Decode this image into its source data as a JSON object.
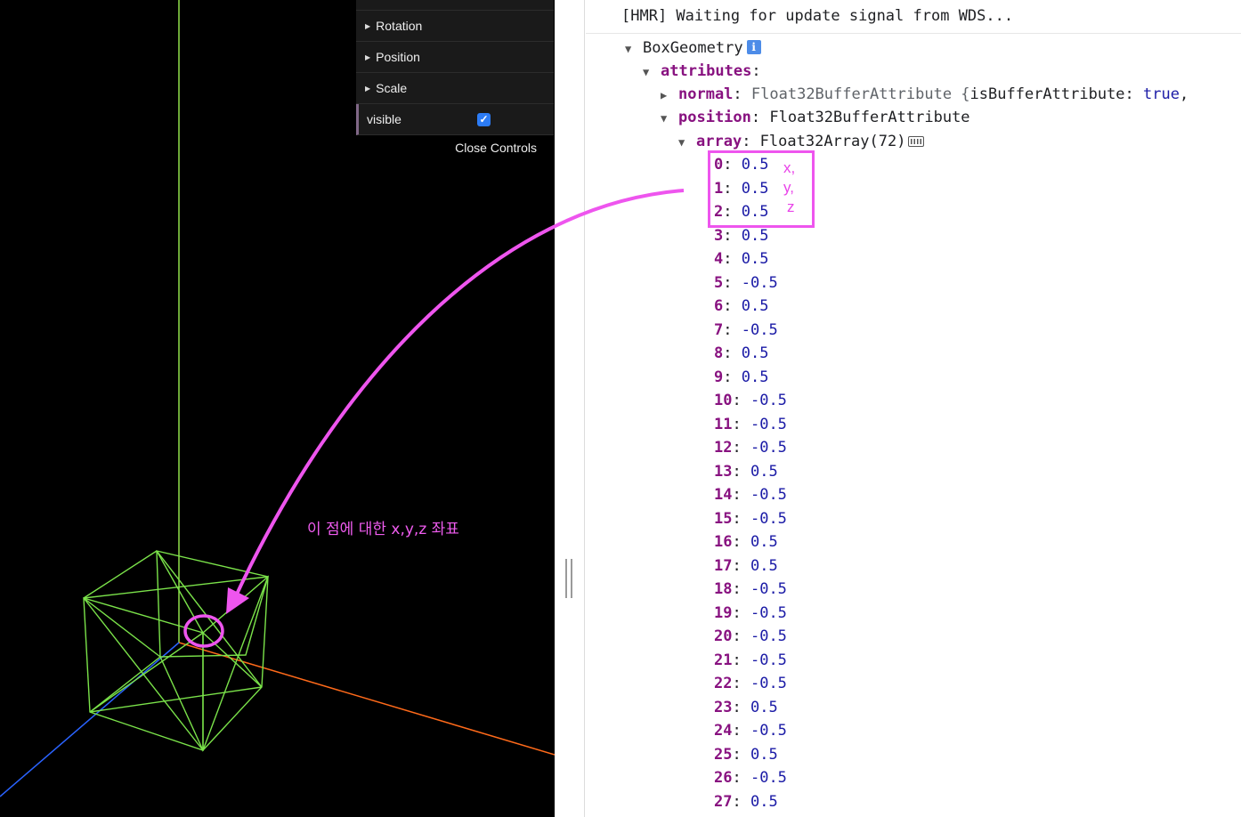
{
  "gui": {
    "folders": [
      {
        "label": "Rotation"
      },
      {
        "label": "Position"
      },
      {
        "label": "Scale"
      }
    ],
    "visible_label": "visible",
    "visible_checked": true,
    "close_label": "Close Controls"
  },
  "console": {
    "hmr": "[HMR] Waiting for update signal from WDS...",
    "geometry_name": "BoxGeometry",
    "info_badge": "i",
    "attributes_key": "attributes",
    "normal_key": "normal",
    "normal_value": "Float32BufferAttribute {isBufferAttribute: true,",
    "normal_type": "Float32BufferAttribute {",
    "normal_prop": "isBufferAttribute",
    "normal_bool": "true",
    "position_key": "position",
    "position_value": "Float32BufferAttribute",
    "array_key": "array",
    "array_value": "Float32Array(72)",
    "entries": [
      {
        "i": "0",
        "v": "0.5"
      },
      {
        "i": "1",
        "v": "0.5"
      },
      {
        "i": "2",
        "v": "0.5"
      },
      {
        "i": "3",
        "v": "0.5"
      },
      {
        "i": "4",
        "v": "0.5"
      },
      {
        "i": "5",
        "v": "-0.5"
      },
      {
        "i": "6",
        "v": "0.5"
      },
      {
        "i": "7",
        "v": "-0.5"
      },
      {
        "i": "8",
        "v": "0.5"
      },
      {
        "i": "9",
        "v": "0.5"
      },
      {
        "i": "10",
        "v": "-0.5"
      },
      {
        "i": "11",
        "v": "-0.5"
      },
      {
        "i": "12",
        "v": "-0.5"
      },
      {
        "i": "13",
        "v": "0.5"
      },
      {
        "i": "14",
        "v": "-0.5"
      },
      {
        "i": "15",
        "v": "-0.5"
      },
      {
        "i": "16",
        "v": "0.5"
      },
      {
        "i": "17",
        "v": "0.5"
      },
      {
        "i": "18",
        "v": "-0.5"
      },
      {
        "i": "19",
        "v": "-0.5"
      },
      {
        "i": "20",
        "v": "-0.5"
      },
      {
        "i": "21",
        "v": "-0.5"
      },
      {
        "i": "22",
        "v": "-0.5"
      },
      {
        "i": "23",
        "v": "0.5"
      },
      {
        "i": "24",
        "v": "-0.5"
      },
      {
        "i": "25",
        "v": "0.5"
      },
      {
        "i": "26",
        "v": "-0.5"
      },
      {
        "i": "27",
        "v": "0.5"
      }
    ]
  },
  "annotation": {
    "label": "이 점에 대한 x,y,z  좌표",
    "letters": [
      "x,",
      "y,",
      "z"
    ],
    "color": "#ee55ee"
  },
  "colors": {
    "wireframe": "#7be34a",
    "axis_x": "#ff6a1a",
    "axis_y": "#8fe04a",
    "axis_z": "#2a63ff"
  }
}
